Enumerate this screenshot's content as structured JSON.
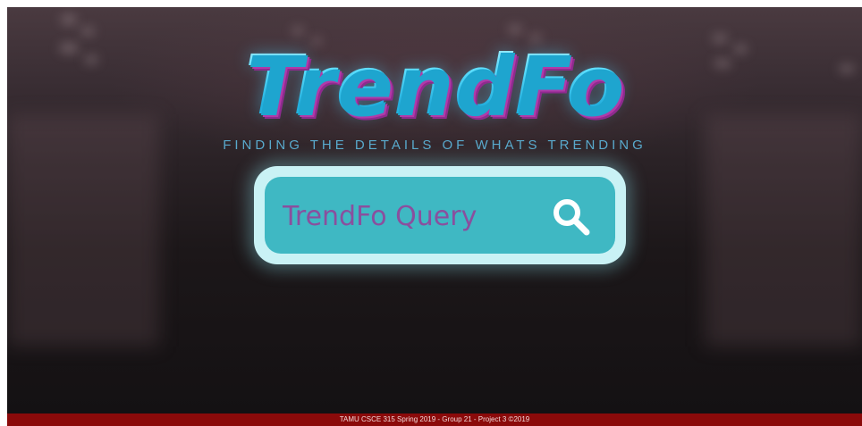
{
  "header": {
    "logo_text": "TrendFo",
    "tagline": "FINDING THE DETAILS OF WHATS TRENDING"
  },
  "search": {
    "placeholder": "TrendFo Query",
    "button_icon": "magnifier-icon"
  },
  "footer": {
    "text": "TAMU CSCE 315 Spring 2019 - Group 21 - Project 3 ©2019"
  },
  "colors": {
    "logo_cyan": "#3fd2f2",
    "logo_magenta": "#b13aa8",
    "search_fill": "#3fb8c3",
    "search_border": "#c9f2f5",
    "placeholder_purple": "#8a4f9e",
    "footer_red": "#8b0a0a"
  }
}
